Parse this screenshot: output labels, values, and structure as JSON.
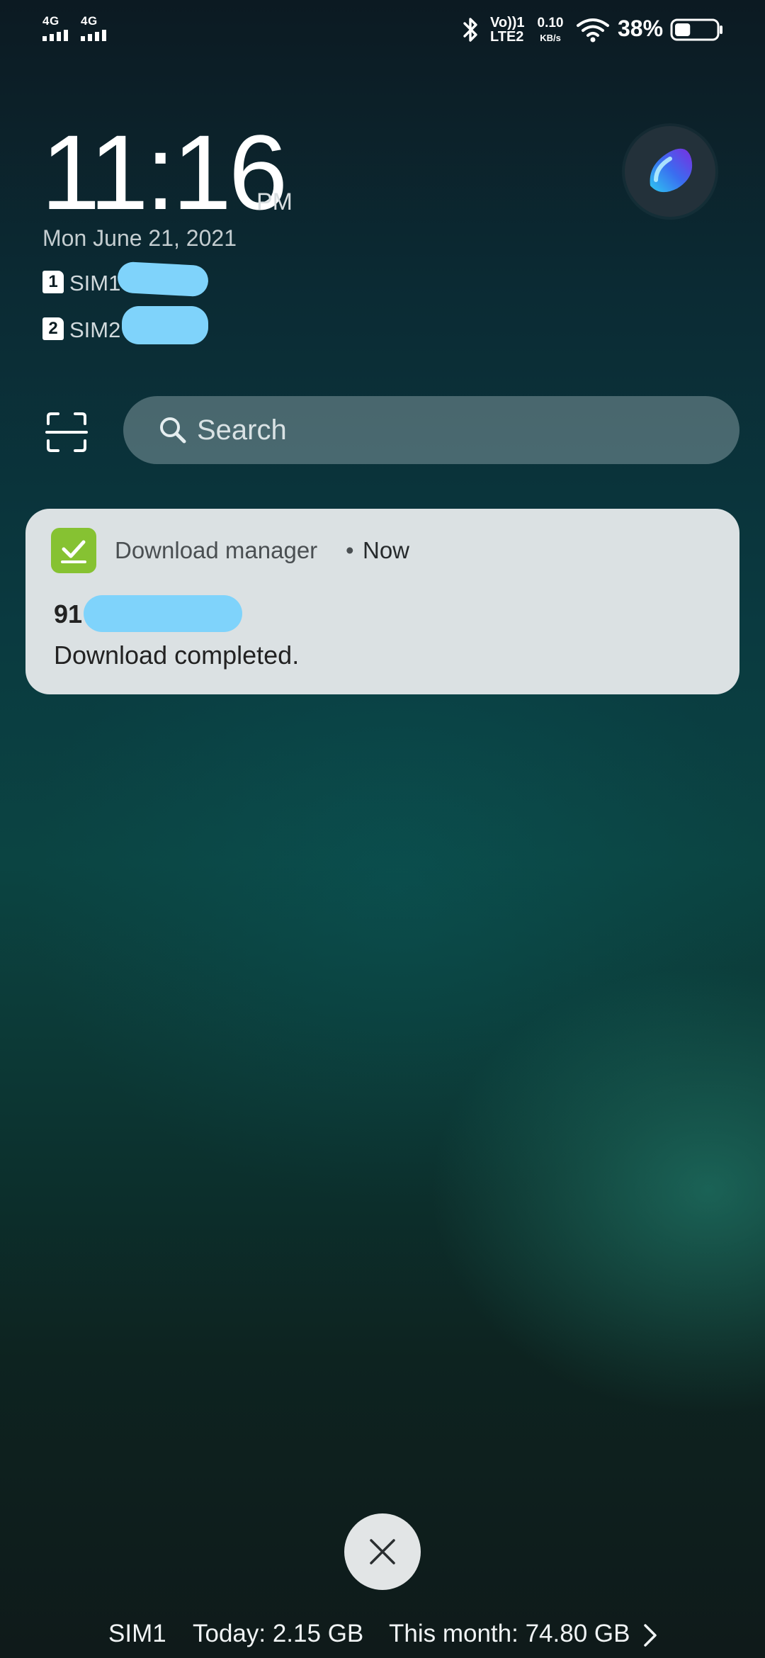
{
  "status_bar": {
    "sim1_network": "4G",
    "sim2_network": "4G",
    "volte_line1": "Vo))1",
    "volte_line2": "LTE2",
    "speed_value": "0.10",
    "speed_unit": "KB/s",
    "battery_percent": "38%",
    "battery_level": 0.38,
    "icons": [
      "bluetooth-icon",
      "wifi-icon",
      "battery-icon"
    ]
  },
  "lock_screen": {
    "time": "11:16",
    "ampm": "PM",
    "date": "Mon June 21, 2021",
    "sims": [
      {
        "number": "1",
        "label": "SIM1"
      },
      {
        "number": "2",
        "label": "SIM2"
      }
    ]
  },
  "search": {
    "placeholder": "Search"
  },
  "notification": {
    "app_name": "Download manager",
    "separator": "•",
    "time": "Now",
    "title": "91",
    "body": "Download completed."
  },
  "data_usage": {
    "sim": "SIM1",
    "today": "Today: 2.15 GB",
    "month": "This month: 74.80 GB"
  },
  "colors": {
    "accent_green": "#86c232",
    "redaction": "#7fd3fb",
    "card_background": "#dbe1e3"
  }
}
